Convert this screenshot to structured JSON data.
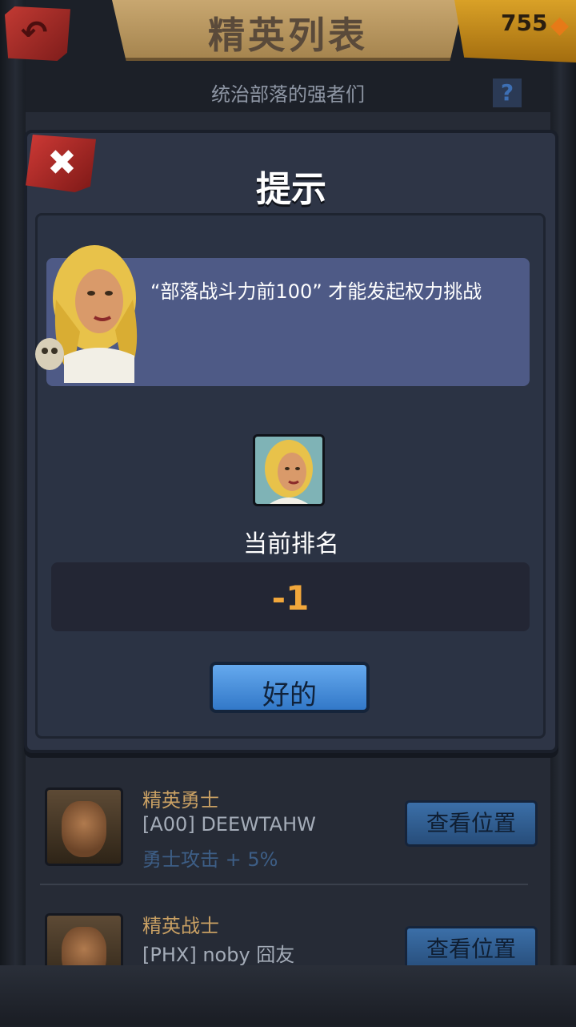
{
  "header": {
    "title": "精英列表",
    "subtitle": "统治部落的强者们",
    "gems": "755",
    "help": "?"
  },
  "dialog": {
    "title": "提示",
    "message": "“部落战斗力前100” 才能发起权力挑战",
    "rank_label": "当前排名",
    "rank_value": "-1",
    "ok_label": "好的"
  },
  "elite_list": [
    {
      "title": "精英勇士",
      "player": "[A00] DEEWTAHW",
      "bonus": "勇士攻击 + 5%",
      "button": "查看位置"
    },
    {
      "title": "精英战士",
      "player": "[PHX] noby 囧友",
      "bonus": "",
      "button": "查看位置"
    }
  ],
  "colors": {
    "dialog_bg": "#2e3546",
    "message_bg": "#4e5a86",
    "rank_value": "#f2a73b",
    "ok_button": "#4a90dd",
    "close_button": "#c7302c",
    "elite_title": "#c9a063"
  },
  "icons": {
    "back": "back-arrow-icon",
    "close": "close-x-icon",
    "gem": "gem-icon",
    "help": "question-icon"
  }
}
